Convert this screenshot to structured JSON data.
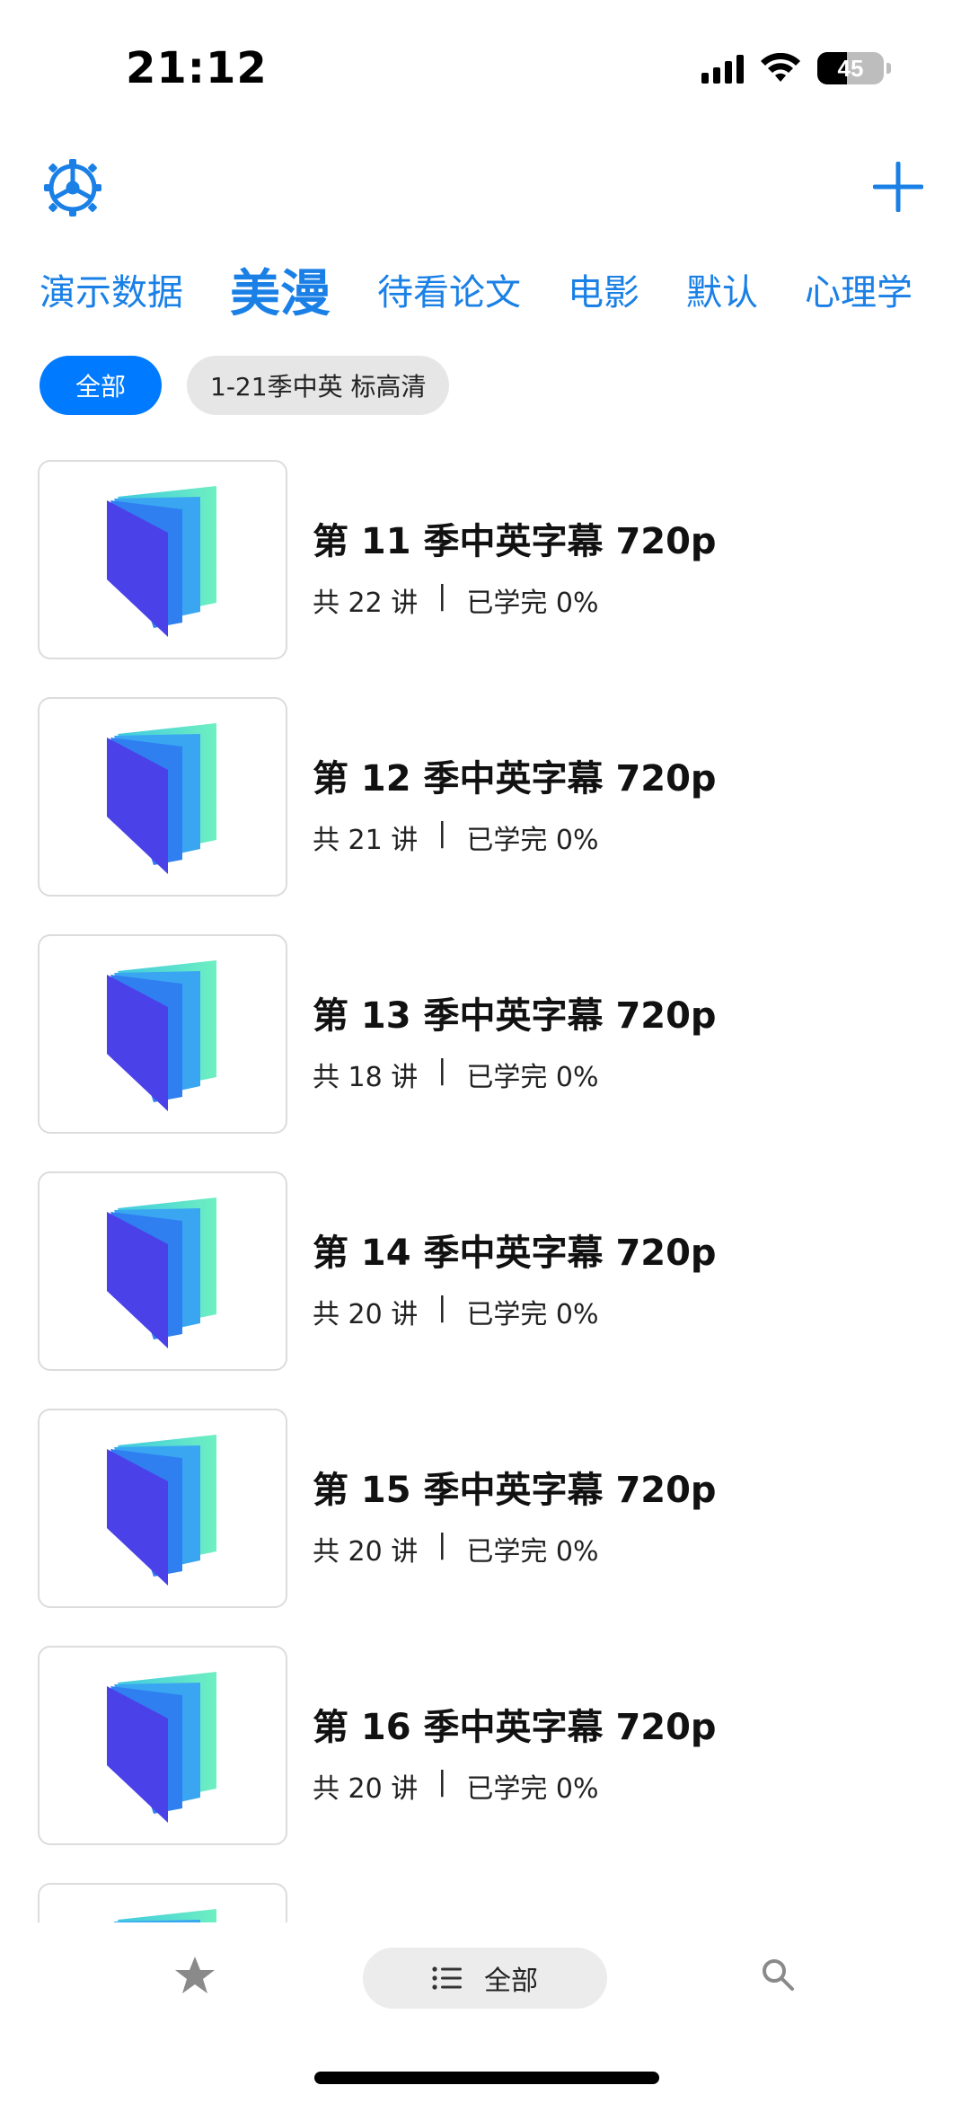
{
  "status_bar": {
    "time": "21:12",
    "battery": "45",
    "battery_level_percent": 45,
    "icons": [
      "cellular-signal-icon",
      "wifi-icon",
      "battery-icon"
    ]
  },
  "top_bar": {
    "settings_icon": "gear-icon",
    "add_icon": "plus-icon",
    "accent_color": "#1a80e6"
  },
  "tabs": [
    {
      "label": "演示数据",
      "active": false
    },
    {
      "label": "美漫",
      "active": true
    },
    {
      "label": "待看论文",
      "active": false
    },
    {
      "label": "电影",
      "active": false
    },
    {
      "label": "默认",
      "active": false
    },
    {
      "label": "心理学",
      "active": false
    }
  ],
  "filters": [
    {
      "label": "全部",
      "active": true
    },
    {
      "label": "1-21季中英 标高清",
      "active": false
    }
  ],
  "courses": [
    {
      "title": "第 11 季中英字幕 720p",
      "lessons": "共 22 讲",
      "progress": "已学完 0%"
    },
    {
      "title": "第 12 季中英字幕 720p",
      "lessons": "共 21 讲",
      "progress": "已学完 0%"
    },
    {
      "title": "第 13 季中英字幕 720p",
      "lessons": "共 18 讲",
      "progress": "已学完 0%"
    },
    {
      "title": "第 14 季中英字幕 720p",
      "lessons": "共 20 讲",
      "progress": "已学完 0%"
    },
    {
      "title": "第 15 季中英字幕 720p",
      "lessons": "共 20 讲",
      "progress": "已学完 0%"
    },
    {
      "title": "第 16 季中英字幕 720p",
      "lessons": "共 20 讲",
      "progress": "已学完 0%"
    },
    {
      "title": "",
      "lessons": "",
      "progress": ""
    }
  ],
  "meta_separator": "|",
  "bottom_bar": {
    "favorites_icon": "star-icon",
    "all_label": "全部",
    "list_icon": "list-icon",
    "search_icon": "search-icon"
  },
  "colors": {
    "primary": "#007aff",
    "tab_text": "#1a80e6",
    "book_dark": "#4a42e8",
    "book_mid": "#2f8ff0",
    "book_light": "#5fe0c0"
  }
}
